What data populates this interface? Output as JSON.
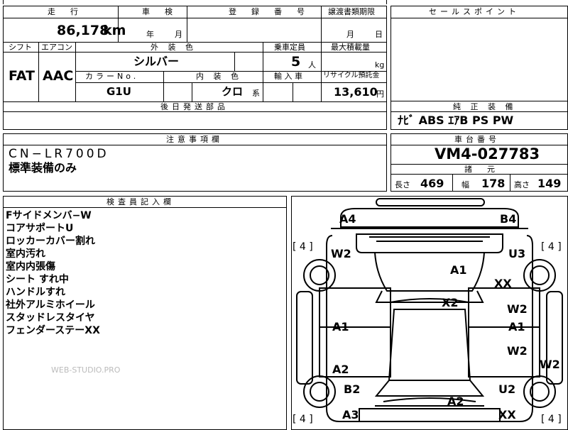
{
  "sheet": {
    "mileage": {
      "label": "走　行",
      "value": "86,178",
      "unit": "km"
    },
    "inspection": {
      "label": "車　検",
      "year_unit": "年",
      "month_unit": "月"
    },
    "registration": {
      "label": "登　録　番　号"
    },
    "transfer_deadline": {
      "label": "譲渡書類期限",
      "month_unit": "月",
      "day_unit": "日"
    },
    "sales_point": {
      "label": "セールスポイント"
    },
    "shift": {
      "label": "シフト",
      "value": "FAT"
    },
    "aircon": {
      "label": "エアコン",
      "value": "AAC"
    },
    "exterior_color": {
      "label": "外 装 色",
      "value": "シルバー"
    },
    "color_no": {
      "label": "カラーNo.",
      "value": "G1U"
    },
    "interior_color": {
      "label": "内 装 色",
      "value": "クロ",
      "suffix": "系"
    },
    "capacity": {
      "label": "乗車定員",
      "value": "5",
      "unit": "人"
    },
    "max_load": {
      "label": "最大積載量",
      "unit": "kg"
    },
    "import": {
      "label": "輸 入 車"
    },
    "recycle": {
      "label": "リサイクル預託金",
      "value": "13,610",
      "unit": "円"
    },
    "deferred_parts": {
      "label": "後日発送部品"
    },
    "equipment": {
      "label": "純 正 装 備",
      "value": "ﾅﾋﾞ  ABS  ｴｱB  PS  PW"
    },
    "notes": {
      "label": "注意事項欄",
      "lines": [
        "CN−LR700D",
        "標準装備のみ"
      ]
    },
    "chassis": {
      "label": "車台番号",
      "value": "VM4-027783"
    },
    "dims": {
      "label": "諸　元",
      "length_label": "長さ",
      "length": "469",
      "width_label": "幅",
      "width": "178",
      "height_label": "高さ",
      "height": "149"
    },
    "inspector": {
      "label": "検査員記入欄",
      "lines": [
        "Fサイドメンバ−W",
        "コアサポートU",
        "ロッカーカバー割れ",
        "室内汚れ",
        "室内内張傷",
        "シート すれ中",
        "ハンドルすれ",
        "社外アルミホイール",
        "スタッドレスタイヤ",
        "フェンダーステーXX"
      ]
    },
    "watermark": "WEB-STUDIO.PRO"
  },
  "diagram": {
    "tires": {
      "fl": "[ 4 ]",
      "fr": "[ 4 ]",
      "rl": "[ 4 ]",
      "rr": "[ 4 ]"
    },
    "marks": {
      "a4": "A4",
      "b4": "B4",
      "w2_fl": "W2",
      "u3": "U3",
      "a1_hood": "A1",
      "xx_fr": "XX",
      "x2": "X2",
      "a1_ld": "A1",
      "w2_rd": "W2",
      "a1_rd": "A1",
      "a2_lr": "A2",
      "w2_rr": "W2",
      "w2_qr": "W2",
      "b2": "B2",
      "u2": "U2",
      "a2_trunk": "A2",
      "a3": "A3",
      "xx_br": "XX"
    }
  }
}
